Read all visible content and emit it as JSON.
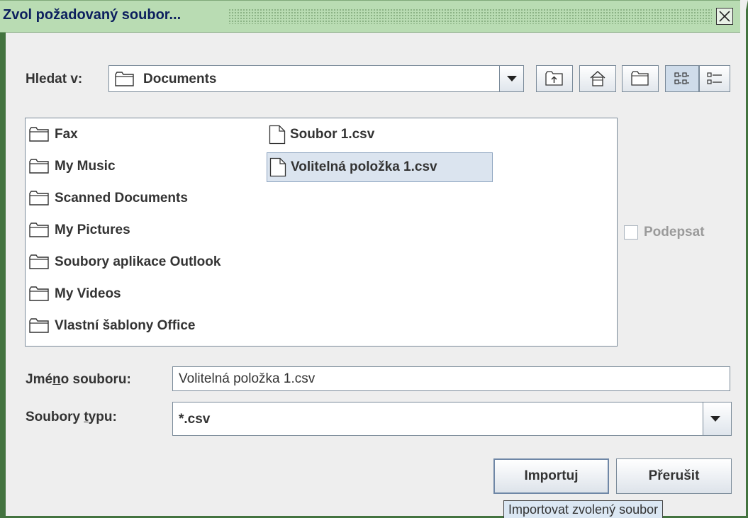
{
  "dialog": {
    "title": "Zvol požadovaný soubor...",
    "close_icon": "close-icon"
  },
  "look_in": {
    "label": "Hledat v:",
    "value": "Documents"
  },
  "toolbar": {
    "icons": [
      "up-folder-icon",
      "home-icon",
      "new-folder-icon",
      "list-view-icon",
      "details-view-icon"
    ]
  },
  "files": {
    "folders": [
      "Fax",
      "My Music",
      "Scanned Documents",
      "My Pictures",
      "Soubory aplikace Outlook",
      "My Videos",
      "Vlastní šablony Office"
    ],
    "documents": [
      "Soubor 1.csv",
      "Volitelná položka 1.csv"
    ],
    "selected": "Volitelná položka 1.csv"
  },
  "sign": {
    "label": "Podepsat",
    "checked": false
  },
  "filename": {
    "label_pre": "Jmé",
    "label_mnemonic": "n",
    "label_post": "o souboru:",
    "value": "Volitelná položka 1.csv"
  },
  "filetype": {
    "label_pre": "Soubory ",
    "label_mnemonic": "t",
    "label_post": "ypu:",
    "value": "*.csv"
  },
  "buttons": {
    "import": "Importuj",
    "cancel": "Přerušit"
  },
  "tooltip": "Importovat zvolený soubor",
  "colors": {
    "window_border": "#43733f",
    "titlebar": "#b9dcb3",
    "title_text": "#0c1f5e",
    "selection": "#dbe4ef"
  }
}
